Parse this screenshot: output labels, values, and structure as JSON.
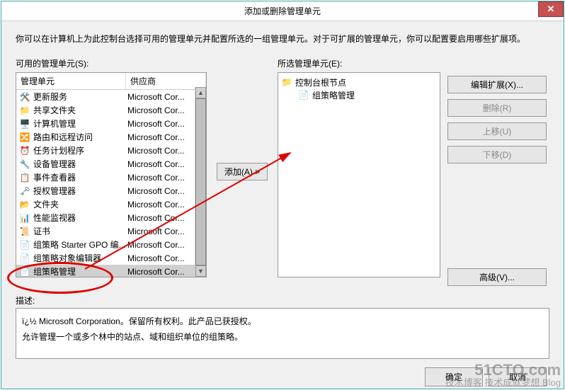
{
  "title": "添加或删除管理单元",
  "instruction": "你可以在计算机上为此控制台选择可用的管理单元并配置所选的一组管理单元。对于可扩展的管理单元，你可以配置要启用哪些扩展项。",
  "available_label": "可用的管理单元(S):",
  "selected_label": "所选管理单元(E):",
  "columns": {
    "snapin": "管理单元",
    "vendor": "供应商"
  },
  "snapins": [
    {
      "name": "更新服务",
      "vendor": "Microsoft Cor..."
    },
    {
      "name": "共享文件夹",
      "vendor": "Microsoft Cor..."
    },
    {
      "name": "计算机管理",
      "vendor": "Microsoft Cor..."
    },
    {
      "name": "路由和远程访问",
      "vendor": "Microsoft Cor..."
    },
    {
      "name": "任务计划程序",
      "vendor": "Microsoft Cor..."
    },
    {
      "name": "设备管理器",
      "vendor": "Microsoft Cor..."
    },
    {
      "name": "事件查看器",
      "vendor": "Microsoft Cor..."
    },
    {
      "name": "授权管理器",
      "vendor": "Microsoft Cor..."
    },
    {
      "name": "文件夹",
      "vendor": "Microsoft Cor..."
    },
    {
      "name": "性能监视器",
      "vendor": "Microsoft Cor..."
    },
    {
      "name": "证书",
      "vendor": "Microsoft Cor..."
    },
    {
      "name": "组策略 Starter GPO 编...",
      "vendor": "Microsoft Cor..."
    },
    {
      "name": "组策略对象编辑器",
      "vendor": "Microsoft Cor..."
    },
    {
      "name": "组策略管理",
      "vendor": "Microsoft Cor..."
    }
  ],
  "selected_snapins": [
    {
      "name": "控制台根节点",
      "root": true
    },
    {
      "name": "组策略管理",
      "root": false
    }
  ],
  "buttons": {
    "add": "添加(A) >",
    "edit_ext": "编辑扩展(X)...",
    "remove": "删除(R)",
    "move_up": "上移(U)",
    "move_down": "下移(D)",
    "advanced": "高级(V)...",
    "ok": "确定",
    "cancel": "取消"
  },
  "desc_label": "描述:",
  "desc_text1": "ï¿½ Microsoft Corporation。保留所有权利。此产品已获授权。",
  "desc_text2": "允许管理一个或多个林中的站点、域和组织单位的组策略。",
  "watermark": {
    "main": "51CTO.com",
    "sub": "技术博客  技术成就梦想 Blog"
  }
}
